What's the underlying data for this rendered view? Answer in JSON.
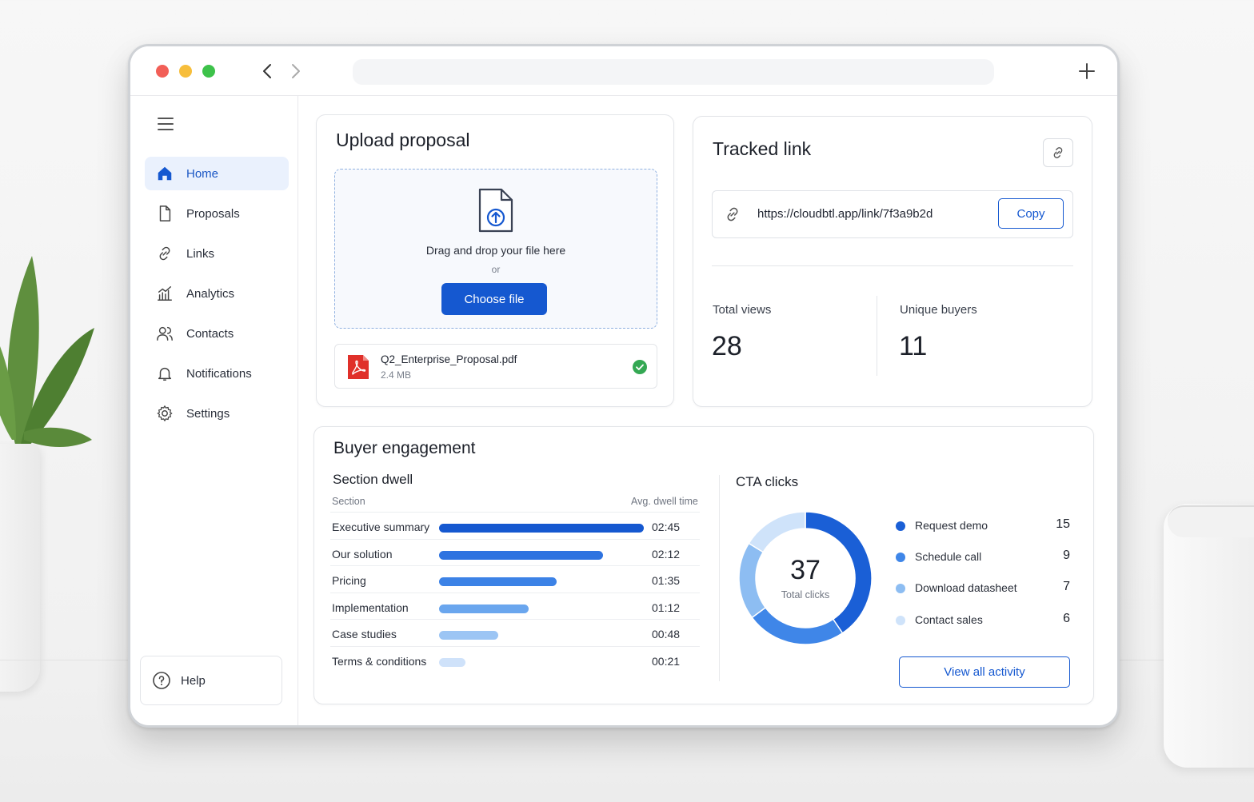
{
  "sidebar": {
    "items": [
      {
        "label": "Home",
        "icon": "home-icon",
        "active": true
      },
      {
        "label": "Proposals",
        "icon": "document-icon"
      },
      {
        "label": "Links",
        "icon": "link-icon"
      },
      {
        "label": "Analytics",
        "icon": "analytics-icon"
      },
      {
        "label": "Contacts",
        "icon": "contacts-icon"
      },
      {
        "label": "Notifications",
        "icon": "bell-icon"
      },
      {
        "label": "Settings",
        "icon": "gear-icon"
      }
    ],
    "help_label": "Help"
  },
  "upload": {
    "title": "Upload proposal",
    "drop_text": "Drag and drop your file here",
    "or_text": "or",
    "choose_label": "Choose file",
    "file": {
      "name": "Q2_Enterprise_Proposal.pdf",
      "size": "2.4 MB",
      "status": "uploaded"
    }
  },
  "tracked_link": {
    "title": "Tracked link",
    "url": "https://cloudbtl.app/link/7f3a9b2d",
    "copy_label": "Copy",
    "total_views_label": "Total views",
    "total_views": "28",
    "unique_buyers_label": "Unique buyers",
    "unique_buyers": "11"
  },
  "engagement": {
    "title": "Buyer engagement",
    "dwell": {
      "title": "Section dwell",
      "col_section": "Section",
      "col_time": "Avg. dwell time",
      "rows": [
        {
          "section": "Executive summary",
          "time": "02:45",
          "seconds": 165,
          "color": "#1558d0"
        },
        {
          "section": "Our solution",
          "time": "02:12",
          "seconds": 132,
          "color": "#2e73e0"
        },
        {
          "section": "Pricing",
          "time": "01:35",
          "seconds": 95,
          "color": "#3c82e6"
        },
        {
          "section": "Implementation",
          "time": "01:12",
          "seconds": 72,
          "color": "#6aa6ee"
        },
        {
          "section": "Case studies",
          "time": "00:48",
          "seconds": 48,
          "color": "#9cc5f4"
        },
        {
          "section": "Terms & conditions",
          "time": "00:21",
          "seconds": 21,
          "color": "#cfe2fa"
        }
      ]
    },
    "cta": {
      "title": "CTA clicks",
      "total": "37",
      "total_label": "Total clicks",
      "items": [
        {
          "label": "Request demo",
          "value": 15,
          "color": "#1a5fd6"
        },
        {
          "label": "Schedule call",
          "value": 9,
          "color": "#3f86e8"
        },
        {
          "label": "Download datasheet",
          "value": 7,
          "color": "#8dbdf2"
        },
        {
          "label": "Contact sales",
          "value": 6,
          "color": "#cfe3fa"
        }
      ],
      "view_all_label": "View all activity"
    }
  }
}
